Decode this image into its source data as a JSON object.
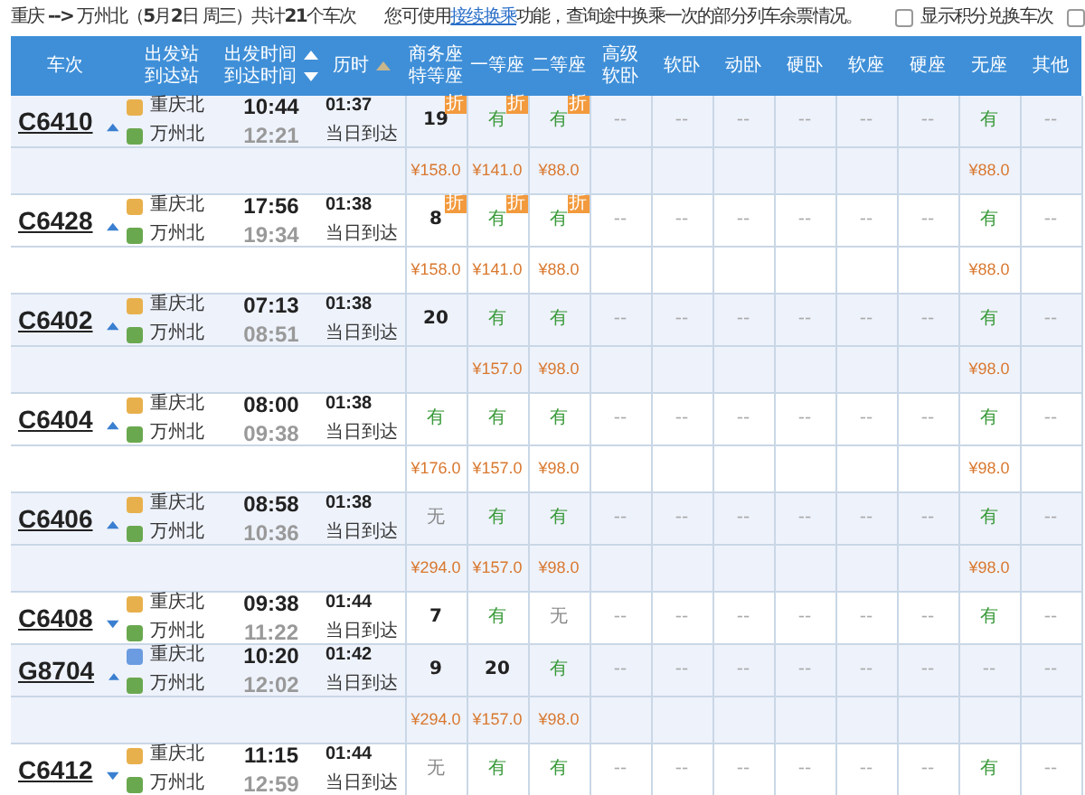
{
  "summary": "重庆 **-->** 万州北（**5**月**2**日  周三）共计**21**个车次",
  "notice": {
    "before": "您可使用",
    "link": "接续换乘",
    "after": "功能，查询途中换乘一次的部分列车余票情况。"
  },
  "options": [
    {
      "label": "显示积分兑换车次",
      "checked": false
    },
    {
      "checked": false
    }
  ],
  "columns": [
    {
      "lines": [
        {
          "text": "车次"
        }
      ]
    },
    {
      "lines": [
        {
          "text": "出发站"
        },
        {
          "text": "到达站"
        }
      ]
    },
    {
      "lines": [
        {
          "text": "出发时间",
          "ascending": true,
          "active": true
        },
        {
          "text": "到达时间",
          "ascending": false,
          "active": true
        }
      ]
    },
    {
      "lines": [
        {
          "text": "历时",
          "ascending": true,
          "active": false
        }
      ]
    },
    {
      "lines": [
        {
          "text": "商务座"
        },
        {
          "text": "特等座"
        }
      ]
    },
    {
      "lines": [
        {
          "text": "一等座"
        }
      ]
    },
    {
      "lines": [
        {
          "text": "二等座"
        }
      ]
    },
    {
      "lines": [
        {
          "text": "高级"
        },
        {
          "text": "软卧"
        }
      ]
    },
    {
      "lines": [
        {
          "text": "软卧"
        }
      ]
    },
    {
      "lines": [
        {
          "text": "动卧"
        }
      ]
    },
    {
      "lines": [
        {
          "text": "硬卧"
        }
      ]
    },
    {
      "lines": [
        {
          "text": "软座"
        }
      ]
    },
    {
      "lines": [
        {
          "text": "硬座"
        }
      ]
    },
    {
      "lines": [
        {
          "text": "无座"
        }
      ]
    },
    {
      "lines": [
        {
          "text": "其他"
        }
      ]
    }
  ],
  "trains": [
    {
      "train": "C6410",
      "expanded": true,
      "origin": {
        "name": "重庆北",
        "color": "#e8b04c"
      },
      "dest": "万州北",
      "dep": "10:44",
      "arr": "12:21",
      "duration": "01:37",
      "arrival_note": "当日到达",
      "seats": [
        {
          "text": "19",
          "kind": "count",
          "badge": "折",
          "price": "¥158.0"
        },
        {
          "text": "有",
          "kind": "yes",
          "badge": "折",
          "price": "¥141.0"
        },
        {
          "text": "有",
          "kind": "yes",
          "badge": "折",
          "price": "¥88.0"
        },
        {
          "text": "--",
          "kind": "dash"
        },
        {
          "text": "--",
          "kind": "dash"
        },
        {
          "text": "--",
          "kind": "dash"
        },
        {
          "text": "--",
          "kind": "dash"
        },
        {
          "text": "--",
          "kind": "dash"
        },
        {
          "text": "--",
          "kind": "dash"
        },
        {
          "text": "有",
          "kind": "yes",
          "price": "¥88.0"
        },
        {
          "text": "--",
          "kind": "dash"
        }
      ]
    },
    {
      "train": "C6428",
      "expanded": true,
      "origin": {
        "name": "重庆北",
        "color": "#e8b04c"
      },
      "dest": "万州北",
      "dep": "17:56",
      "arr": "19:34",
      "duration": "01:38",
      "arrival_note": "当日到达",
      "seats": [
        {
          "text": "8",
          "kind": "count",
          "badge": "折",
          "price": "¥158.0"
        },
        {
          "text": "有",
          "kind": "yes",
          "badge": "折",
          "price": "¥141.0"
        },
        {
          "text": "有",
          "kind": "yes",
          "badge": "折",
          "price": "¥88.0"
        },
        {
          "text": "--",
          "kind": "dash"
        },
        {
          "text": "--",
          "kind": "dash"
        },
        {
          "text": "--",
          "kind": "dash"
        },
        {
          "text": "--",
          "kind": "dash"
        },
        {
          "text": "--",
          "kind": "dash"
        },
        {
          "text": "--",
          "kind": "dash"
        },
        {
          "text": "有",
          "kind": "yes",
          "price": "¥88.0"
        },
        {
          "text": "--",
          "kind": "dash"
        }
      ]
    },
    {
      "train": "C6402",
      "expanded": true,
      "origin": {
        "name": "重庆北",
        "color": "#e8b04c"
      },
      "dest": "万州北",
      "dep": "07:13",
      "arr": "08:51",
      "duration": "01:38",
      "arrival_note": "当日到达",
      "seats": [
        {
          "text": "20",
          "kind": "count"
        },
        {
          "text": "有",
          "kind": "yes",
          "price": "¥157.0"
        },
        {
          "text": "有",
          "kind": "yes",
          "price": "¥98.0"
        },
        {
          "text": "--",
          "kind": "dash"
        },
        {
          "text": "--",
          "kind": "dash"
        },
        {
          "text": "--",
          "kind": "dash"
        },
        {
          "text": "--",
          "kind": "dash"
        },
        {
          "text": "--",
          "kind": "dash"
        },
        {
          "text": "--",
          "kind": "dash"
        },
        {
          "text": "有",
          "kind": "yes",
          "price": "¥98.0"
        },
        {
          "text": "--",
          "kind": "dash"
        }
      ]
    },
    {
      "train": "C6404",
      "expanded": true,
      "origin": {
        "name": "重庆北",
        "color": "#e8b04c"
      },
      "dest": "万州北",
      "dep": "08:00",
      "arr": "09:38",
      "duration": "01:38",
      "arrival_note": "当日到达",
      "seats": [
        {
          "text": "有",
          "kind": "yes",
          "price": "¥176.0"
        },
        {
          "text": "有",
          "kind": "yes",
          "price": "¥157.0"
        },
        {
          "text": "有",
          "kind": "yes",
          "price": "¥98.0"
        },
        {
          "text": "--",
          "kind": "dash"
        },
        {
          "text": "--",
          "kind": "dash"
        },
        {
          "text": "--",
          "kind": "dash"
        },
        {
          "text": "--",
          "kind": "dash"
        },
        {
          "text": "--",
          "kind": "dash"
        },
        {
          "text": "--",
          "kind": "dash"
        },
        {
          "text": "有",
          "kind": "yes",
          "price": "¥98.0"
        },
        {
          "text": "--",
          "kind": "dash"
        }
      ]
    },
    {
      "train": "C6406",
      "expanded": true,
      "origin": {
        "name": "重庆北",
        "color": "#e8b04c"
      },
      "dest": "万州北",
      "dep": "08:58",
      "arr": "10:36",
      "duration": "01:38",
      "arrival_note": "当日到达",
      "seats": [
        {
          "text": "无",
          "kind": "none",
          "price": "¥294.0"
        },
        {
          "text": "有",
          "kind": "yes",
          "price": "¥157.0"
        },
        {
          "text": "有",
          "kind": "yes",
          "price": "¥98.0"
        },
        {
          "text": "--",
          "kind": "dash"
        },
        {
          "text": "--",
          "kind": "dash"
        },
        {
          "text": "--",
          "kind": "dash"
        },
        {
          "text": "--",
          "kind": "dash"
        },
        {
          "text": "--",
          "kind": "dash"
        },
        {
          "text": "--",
          "kind": "dash"
        },
        {
          "text": "有",
          "kind": "yes",
          "price": "¥98.0"
        },
        {
          "text": "--",
          "kind": "dash"
        }
      ]
    },
    {
      "train": "C6408",
      "expanded": false,
      "origin": {
        "name": "重庆北",
        "color": "#e8b04c"
      },
      "dest": "万州北",
      "dep": "09:38",
      "arr": "11:22",
      "duration": "01:44",
      "arrival_note": "当日到达",
      "seats": [
        {
          "text": "7",
          "kind": "count"
        },
        {
          "text": "有",
          "kind": "yes"
        },
        {
          "text": "无",
          "kind": "none"
        },
        {
          "text": "--",
          "kind": "dash"
        },
        {
          "text": "--",
          "kind": "dash"
        },
        {
          "text": "--",
          "kind": "dash"
        },
        {
          "text": "--",
          "kind": "dash"
        },
        {
          "text": "--",
          "kind": "dash"
        },
        {
          "text": "--",
          "kind": "dash"
        },
        {
          "text": "有",
          "kind": "yes"
        },
        {
          "text": "--",
          "kind": "dash"
        }
      ]
    },
    {
      "train": "G8704",
      "expanded": true,
      "origin": {
        "name": "重庆北",
        "color": "#6b9be0"
      },
      "dest": "万州北",
      "dep": "10:20",
      "arr": "12:02",
      "duration": "01:42",
      "arrival_note": "当日到达",
      "seats": [
        {
          "text": "9",
          "kind": "count",
          "price": "¥294.0"
        },
        {
          "text": "20",
          "kind": "count",
          "price": "¥157.0"
        },
        {
          "text": "有",
          "kind": "yes",
          "price": "¥98.0"
        },
        {
          "text": "--",
          "kind": "dash"
        },
        {
          "text": "--",
          "kind": "dash"
        },
        {
          "text": "--",
          "kind": "dash"
        },
        {
          "text": "--",
          "kind": "dash"
        },
        {
          "text": "--",
          "kind": "dash"
        },
        {
          "text": "--",
          "kind": "dash"
        },
        {
          "text": "--",
          "kind": "dash"
        },
        {
          "text": "--",
          "kind": "dash"
        }
      ]
    },
    {
      "train": "C6412",
      "expanded": false,
      "origin": {
        "name": "重庆北",
        "color": "#e8b04c"
      },
      "dest": "万州北",
      "dep": "11:15",
      "arr": "12:59",
      "duration": "01:44",
      "arrival_note": "当日到达",
      "seats": [
        {
          "text": "无",
          "kind": "none"
        },
        {
          "text": "有",
          "kind": "yes"
        },
        {
          "text": "有",
          "kind": "yes"
        },
        {
          "text": "--",
          "kind": "dash"
        },
        {
          "text": "--",
          "kind": "dash"
        },
        {
          "text": "--",
          "kind": "dash"
        },
        {
          "text": "--",
          "kind": "dash"
        },
        {
          "text": "--",
          "kind": "dash"
        },
        {
          "text": "--",
          "kind": "dash"
        },
        {
          "text": "有",
          "kind": "yes"
        },
        {
          "text": "--",
          "kind": "dash"
        }
      ]
    }
  ]
}
